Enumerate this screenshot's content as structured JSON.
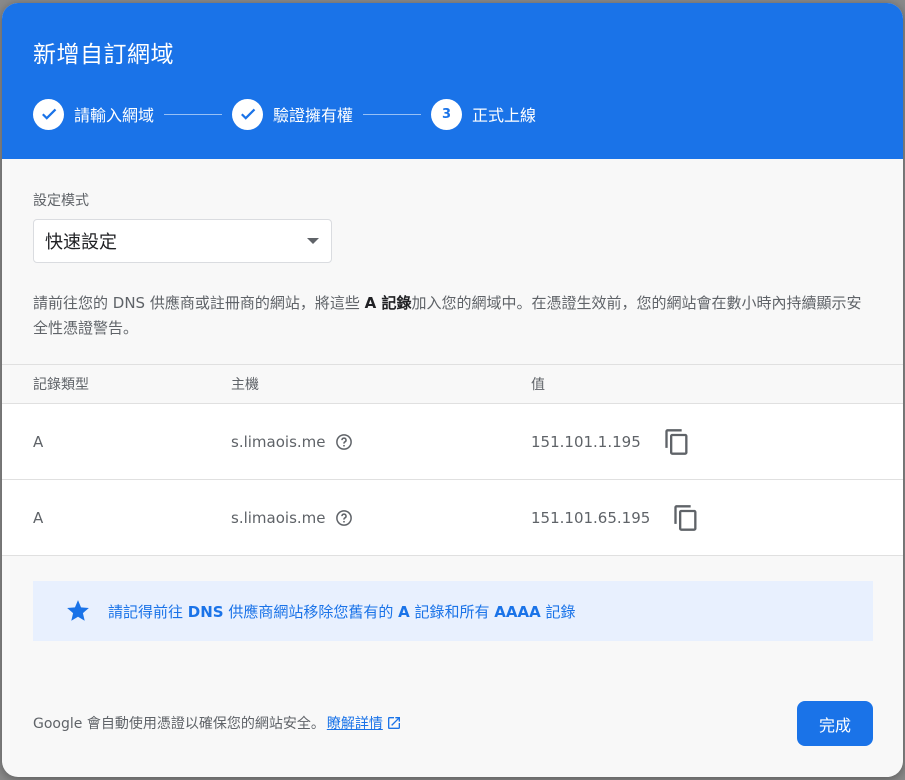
{
  "dialog": {
    "title": "新增自訂網域",
    "steps": [
      {
        "label": "請輸入網域",
        "state": "done"
      },
      {
        "label": "驗證擁有權",
        "state": "done"
      },
      {
        "label": "正式上線",
        "number": "3",
        "state": "current"
      }
    ]
  },
  "config": {
    "mode_label": "設定模式",
    "mode_value": "快速設定"
  },
  "description": {
    "part1": "請前往您的 DNS 供應商或註冊商的網站，將這些 ",
    "bold": "A 記錄",
    "part2": "加入您的網域中。在憑證生效前，您的網站會在數小時內持續顯示安全性憑證警告。"
  },
  "table": {
    "headers": {
      "type": "記錄類型",
      "host": "主機",
      "value": "值"
    },
    "rows": [
      {
        "type": "A",
        "host": "s.limaois.me",
        "value": "151.101.1.195"
      },
      {
        "type": "A",
        "host": "s.limaois.me",
        "value": "151.101.65.195"
      }
    ]
  },
  "notice": {
    "t1": "請記得前往 ",
    "b1": "DNS",
    "t2": " 供應商網站移除您舊有的 ",
    "b2": "A",
    "t3": " 記錄和所有 ",
    "b3": "AAAA",
    "t4": " 記錄"
  },
  "footer": {
    "text": "Google 會自動使用憑證以確保您的網站安全。",
    "link": "瞭解詳情",
    "done_button": "完成"
  },
  "colors": {
    "accent": "#1a73e8",
    "notice_bg": "#e8f0fe"
  }
}
